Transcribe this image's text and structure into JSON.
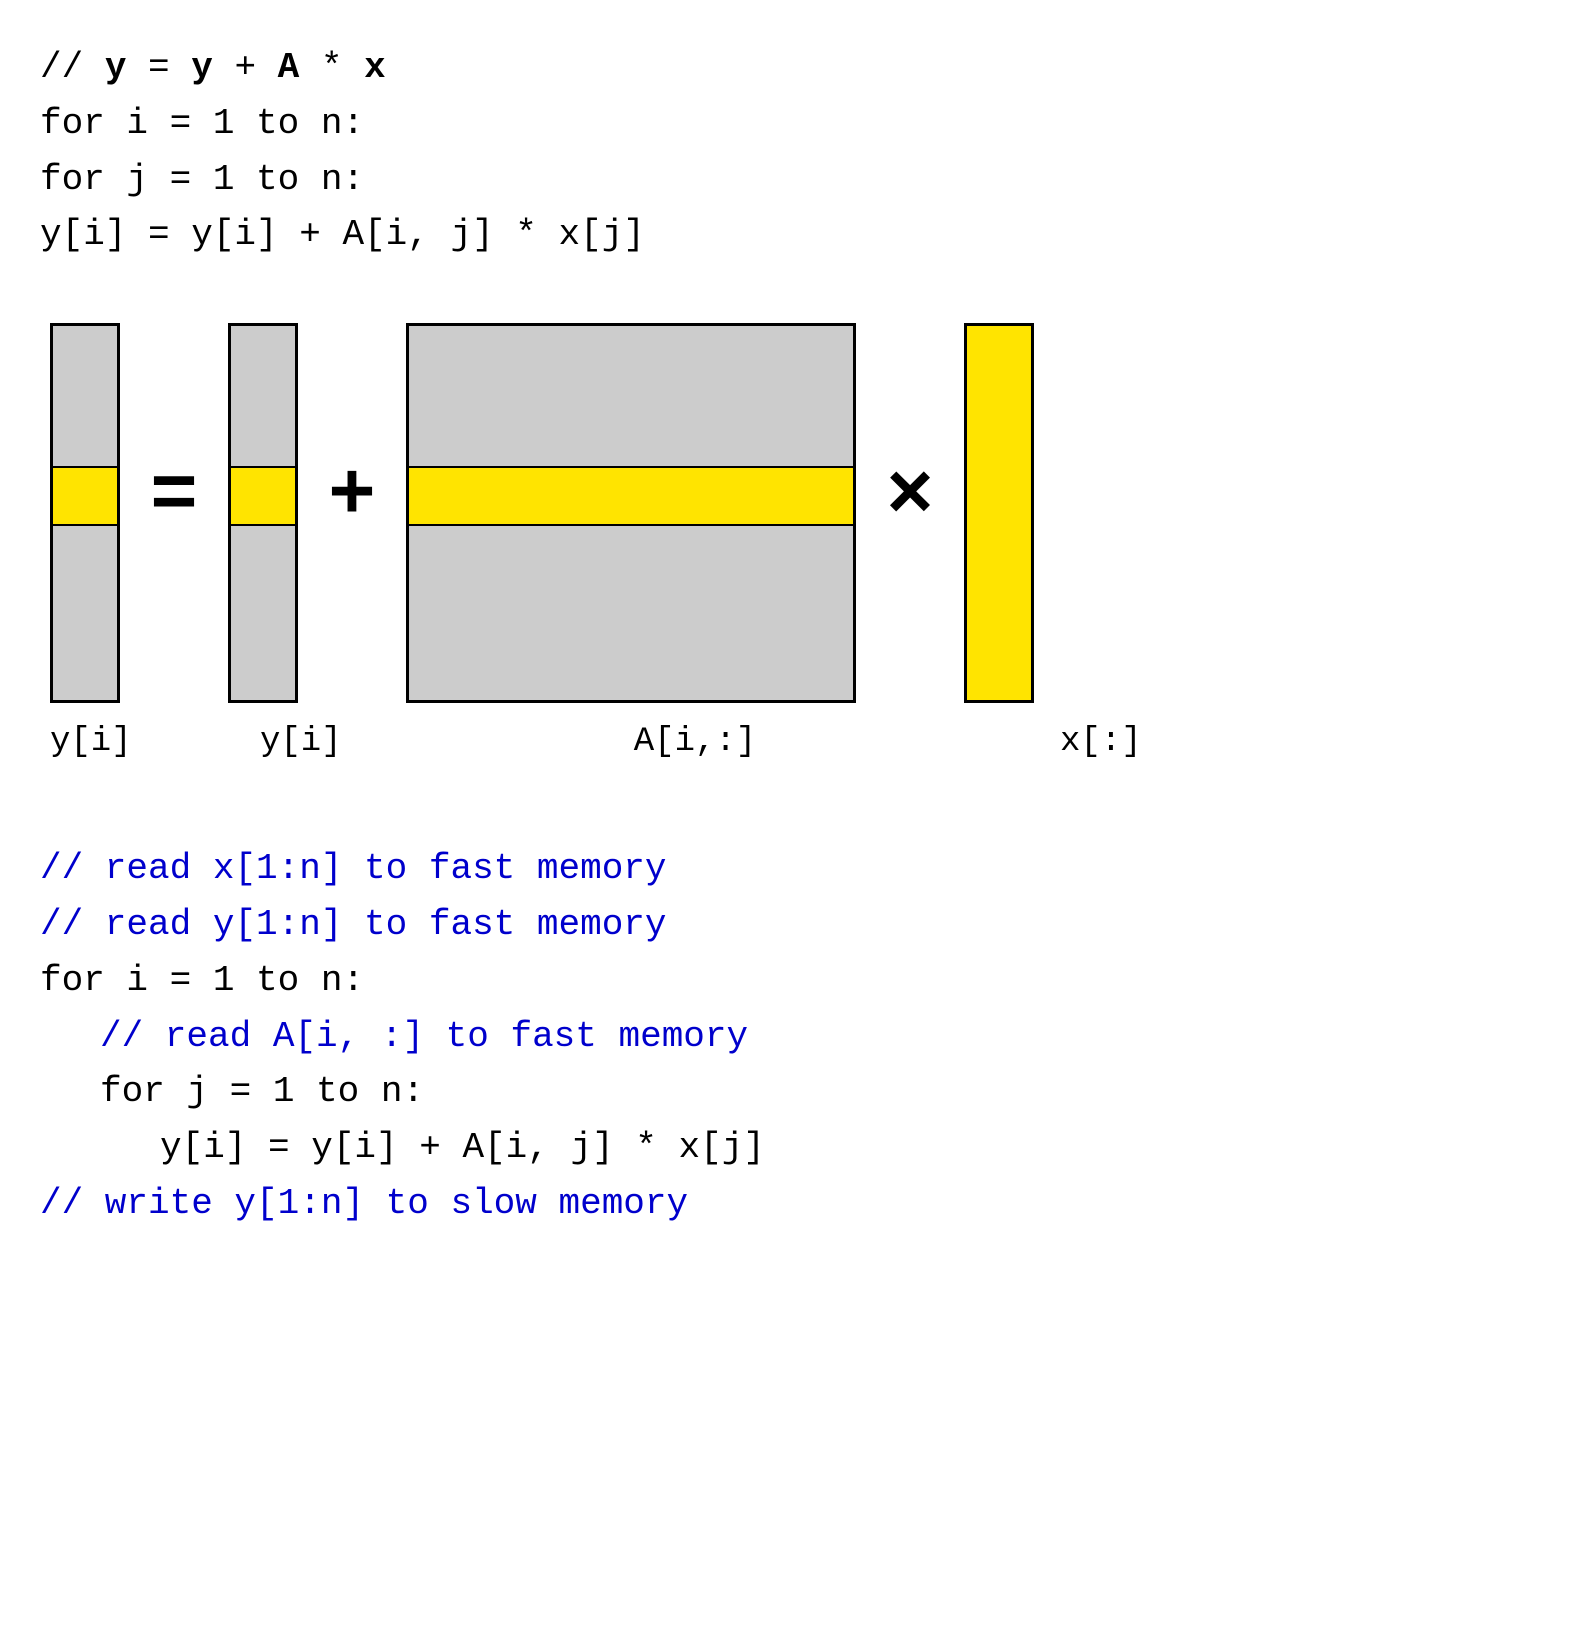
{
  "top_code": {
    "line1_comment": "// ",
    "line1_bold_start": "y",
    "line1_eq": " = ",
    "line1_bold_y": "y",
    "line1_plus": " + ",
    "line1_bold_a": "A",
    "line1_times": " * ",
    "line1_bold_x": "x",
    "line2": "for i = 1 to n:",
    "line3": "  for j = 1 to n:",
    "line4": "    y[i] = y[i] + A[i, j] * x[j]"
  },
  "diagram": {
    "label_y_left": "y[i]",
    "operator_eq": "=",
    "label_y_mid": "y[i]",
    "operator_plus": "+",
    "label_a": "A[i,:]",
    "operator_times": "×",
    "label_x": "x[:]"
  },
  "bottom_code": {
    "line1": "// read x[1:n] to fast memory",
    "line2": "// read y[1:n] to fast memory",
    "line3": "for i = 1 to n:",
    "line4": "  // read A[i, :] to fast memory",
    "line5": "  for j = 1 to n:",
    "line6": "    y[i] = y[i] + A[i, j] * x[j]",
    "line7": "// write y[1:n] to slow memory"
  },
  "colors": {
    "highlight_yellow": "#FFE400",
    "matrix_gray": "#cccccc",
    "blue_comment": "#0000CC",
    "black": "#000000"
  }
}
